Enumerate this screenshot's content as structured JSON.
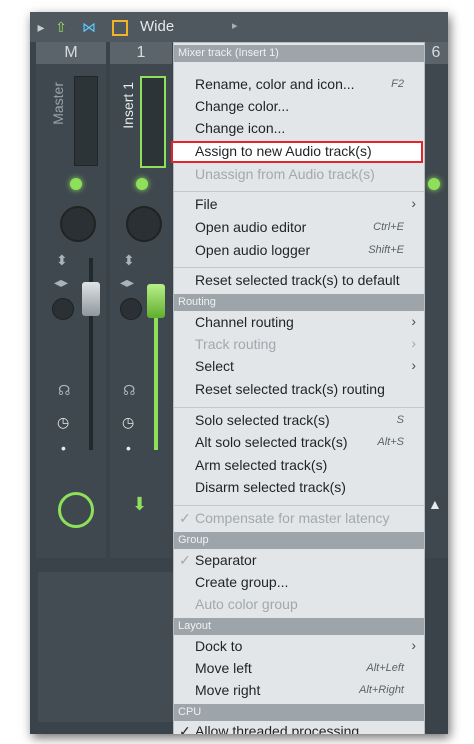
{
  "toolbar": {
    "wide_label": "Wide"
  },
  "strips": {
    "master_header": "M",
    "master_name": "Master",
    "insert1_header": "1",
    "insert1_name": "Insert 1",
    "right_header": "6"
  },
  "menu": {
    "title": "Mixer track (Insert 1)",
    "items_top": [
      {
        "label": "Rename, color and icon...",
        "shortcut": "F2",
        "enabled": true
      },
      {
        "label": "Change color...",
        "shortcut": "",
        "enabled": true
      },
      {
        "label": "Change icon...",
        "shortcut": "",
        "enabled": true
      },
      {
        "label": "Assign to new Audio track(s)",
        "shortcut": "",
        "enabled": true,
        "highlighted": true
      },
      {
        "label": "Unassign from Audio track(s)",
        "shortcut": "",
        "enabled": false
      }
    ],
    "items_file": [
      {
        "label": "File",
        "submenu": true
      },
      {
        "label": "Open audio editor",
        "shortcut": "Ctrl+E"
      },
      {
        "label": "Open audio logger",
        "shortcut": "Shift+E"
      }
    ],
    "reset_default": "Reset selected track(s) to default",
    "routing_header": "Routing",
    "routing_items": [
      {
        "label": "Channel routing",
        "submenu": true,
        "enabled": true
      },
      {
        "label": "Track routing",
        "submenu": true,
        "enabled": false
      },
      {
        "label": "Select",
        "submenu": true,
        "enabled": true
      },
      {
        "label": "Reset selected track(s) routing",
        "enabled": true
      }
    ],
    "solo_items": [
      {
        "label": "Solo selected track(s)",
        "shortcut": "S"
      },
      {
        "label": "Alt solo selected track(s)",
        "shortcut": "Alt+S"
      },
      {
        "label": "Arm selected track(s)",
        "shortcut": ""
      },
      {
        "label": "Disarm selected track(s)",
        "shortcut": ""
      }
    ],
    "compensate": {
      "label": "Compensate for master latency",
      "checked": true,
      "enabled": false
    },
    "group_header": "Group",
    "group_items": [
      {
        "label": "Separator",
        "checked": true
      },
      {
        "label": "Create group..."
      },
      {
        "label": "Auto color group",
        "enabled": false
      }
    ],
    "layout_header": "Layout",
    "layout_items": [
      {
        "label": "Dock to",
        "submenu": true
      },
      {
        "label": "Move left",
        "shortcut": "Alt+Left"
      },
      {
        "label": "Move right",
        "shortcut": "Alt+Right"
      }
    ],
    "cpu_header": "CPU",
    "cpu_items": [
      {
        "label": "Allow threaded processing",
        "checked": true
      }
    ]
  },
  "glyphs": {
    "submenu_arrow": "›",
    "check": "✓"
  },
  "colors": {
    "accent_green": "#8ee05a",
    "highlight_red": "#e2252b",
    "menu_bg": "#e3e6e8"
  }
}
